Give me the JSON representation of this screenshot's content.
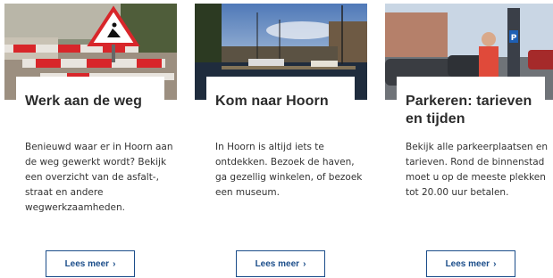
{
  "cards": [
    {
      "title": "Werk aan de weg",
      "description": "Benieuwd waar er in Hoorn aan de weg gewerkt wordt? Bekijk een overzicht van de asfalt-, straat en andere wegwerkzaamheden.",
      "button_label": "Lees meer",
      "image": "roadwork-photo"
    },
    {
      "title": "Kom naar Hoorn",
      "description": "In Hoorn is altijd iets te ontdekken. Bezoek de haven, ga gezellig winkelen, of bezoek een museum.",
      "button_label": "Lees meer",
      "image": "harbour-photo"
    },
    {
      "title": "Parkeren: tarieven en tijden",
      "description": "Bekijk alle parkeerplaatsen en tarieven. Rond de binnenstad moet u op de meeste plekken tot 20.00 uur betalen.",
      "button_label": "Lees meer",
      "image": "parking-photo"
    }
  ],
  "icons": {
    "button_chevron": "chevron-right-icon"
  },
  "colors": {
    "button_border": "#1b4d8a",
    "button_text": "#1b4d8a",
    "title": "#2b2b2b"
  }
}
